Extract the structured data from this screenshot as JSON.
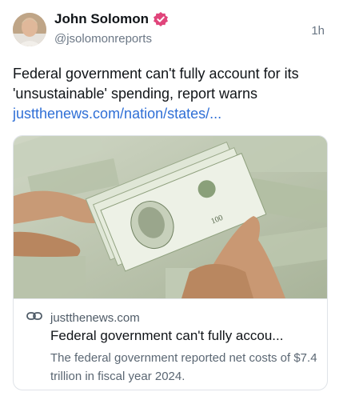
{
  "author": {
    "name": "John Solomon",
    "handle": "@jsolomonreports",
    "time": "1h",
    "verified_color": "#e0457b"
  },
  "post": {
    "text": "Federal government can't fully account for its 'unsustainable' spending, report warns",
    "link_text": "justthenews.com/nation/states/..."
  },
  "card": {
    "domain": "justthenews.com",
    "title": "Federal government can't fully accou...",
    "description": "The federal government reported net costs of $7.4 trillion in fiscal year 2024."
  },
  "colors": {
    "link": "#2f6fd6",
    "muted": "#6b7785"
  }
}
